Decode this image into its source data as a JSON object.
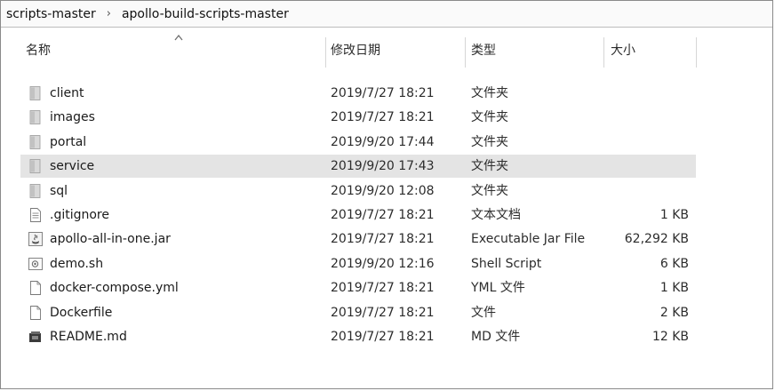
{
  "breadcrumb": {
    "items": [
      "scripts-master",
      "apollo-build-scripts-master"
    ],
    "separator": "›"
  },
  "columns": {
    "name": "名称",
    "modified": "修改日期",
    "type": "类型",
    "size": "大小"
  },
  "files": [
    {
      "name": "client",
      "modified": "2019/7/27 18:21",
      "type": "文件夹",
      "size": "",
      "icon": "folder-icon",
      "selected": false
    },
    {
      "name": "images",
      "modified": "2019/7/27 18:21",
      "type": "文件夹",
      "size": "",
      "icon": "folder-icon",
      "selected": false
    },
    {
      "name": "portal",
      "modified": "2019/9/20 17:44",
      "type": "文件夹",
      "size": "",
      "icon": "folder-icon",
      "selected": false
    },
    {
      "name": "service",
      "modified": "2019/9/20 17:43",
      "type": "文件夹",
      "size": "",
      "icon": "folder-icon",
      "selected": true
    },
    {
      "name": "sql",
      "modified": "2019/9/20 12:08",
      "type": "文件夹",
      "size": "",
      "icon": "folder-icon",
      "selected": false
    },
    {
      "name": ".gitignore",
      "modified": "2019/7/27 18:21",
      "type": "文本文档",
      "size": "1 KB",
      "icon": "text-document-icon",
      "selected": false
    },
    {
      "name": "apollo-all-in-one.jar",
      "modified": "2019/7/27 18:21",
      "type": "Executable Jar File",
      "size": "62,292 KB",
      "icon": "java-jar-icon",
      "selected": false
    },
    {
      "name": "demo.sh",
      "modified": "2019/9/20 12:16",
      "type": "Shell Script",
      "size": "6 KB",
      "icon": "shell-script-icon",
      "selected": false
    },
    {
      "name": "docker-compose.yml",
      "modified": "2019/7/27 18:21",
      "type": "YML 文件",
      "size": "1 KB",
      "icon": "blank-file-icon",
      "selected": false
    },
    {
      "name": "Dockerfile",
      "modified": "2019/7/27 18:21",
      "type": "文件",
      "size": "2 KB",
      "icon": "blank-file-icon",
      "selected": false
    },
    {
      "name": "README.md",
      "modified": "2019/7/27 18:21",
      "type": "MD 文件",
      "size": "12 KB",
      "icon": "markdown-file-icon",
      "selected": false
    }
  ]
}
